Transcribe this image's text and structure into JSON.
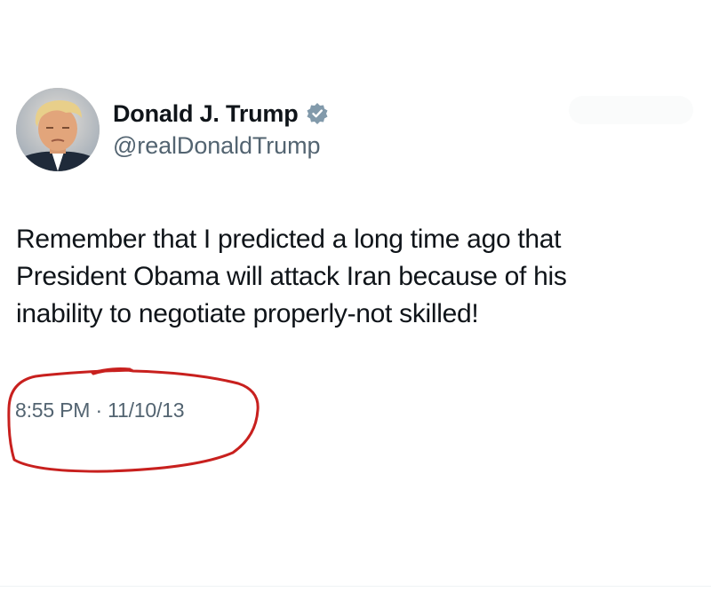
{
  "author": {
    "display_name": "Donald J. Trump",
    "handle": "@realDonaldTrump",
    "avatar": "profile-photo",
    "verified": true,
    "verified_icon": "verified-badge-icon"
  },
  "tweet": {
    "lines": [
      "Remember that I predicted a long time ago that",
      "President Obama will attack Iran because of his",
      "inability to negotiate properly-not skilled!"
    ],
    "timestamp": "8:55 PM · 11/10/13"
  },
  "annotation": {
    "shape": "hand-drawn-circle",
    "color": "#c8201e"
  },
  "colors": {
    "text_primary": "#0f1419",
    "text_secondary": "#536471",
    "verified_badge": "#829aab",
    "background": "#ffffff"
  }
}
